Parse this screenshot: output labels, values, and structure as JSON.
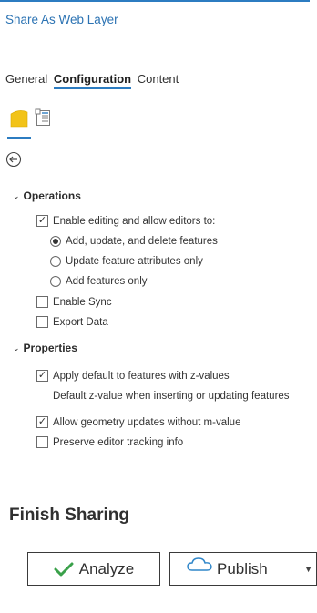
{
  "pane": {
    "title": "Share As Web Layer",
    "tabs": [
      {
        "label": "General",
        "active": false
      },
      {
        "label": "Configuration",
        "active": true
      },
      {
        "label": "Content",
        "active": false
      }
    ],
    "subtab_icons": [
      "feature-layer-icon",
      "properties-list-icon"
    ],
    "back_icon": "back-arrow-icon"
  },
  "operations": {
    "heading": "Operations",
    "enable_editing": {
      "label": "Enable editing and allow editors to:",
      "checked": true
    },
    "edit_options": [
      {
        "label": "Add, update, and delete features",
        "selected": true
      },
      {
        "label": "Update feature attributes only",
        "selected": false
      },
      {
        "label": "Add features only",
        "selected": false
      }
    ],
    "enable_sync": {
      "label": "Enable Sync",
      "checked": false
    },
    "export_data": {
      "label": "Export Data",
      "checked": false
    }
  },
  "properties": {
    "heading": "Properties",
    "apply_default_z": {
      "label": "Apply default to features with z-values",
      "checked": true
    },
    "default_z_text": "Default z-value when inserting or updating features",
    "allow_geometry": {
      "label": "Allow geometry updates without m-value",
      "checked": true
    },
    "preserve_tracking": {
      "label": "Preserve editor tracking info",
      "checked": false
    }
  },
  "finish": {
    "title": "Finish Sharing",
    "analyze_label": "Analyze",
    "publish_label": "Publish"
  },
  "colors": {
    "accent": "#2c7cc1",
    "title": "#2c73b3",
    "check_green": "#3aa14a",
    "cloud_blue": "#2f86c9"
  }
}
